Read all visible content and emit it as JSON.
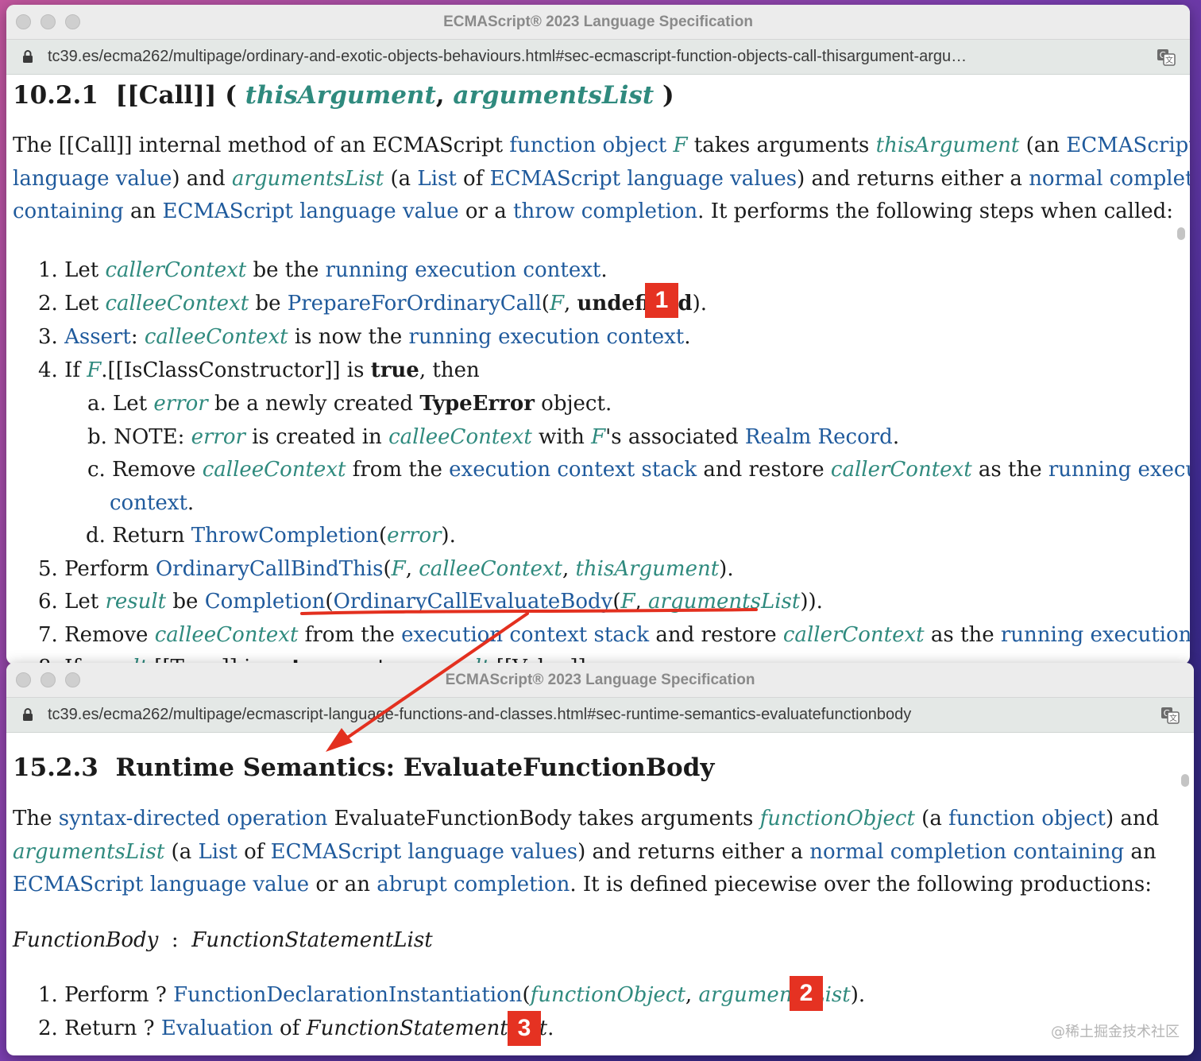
{
  "window1": {
    "title": "ECMAScript® 2023 Language Specification",
    "url": "tc39.es/ecma262/multipage/ordinary-and-exotic-objects-behaviours.html#sec-ecmascript-function-objects-call-thisargument-argu…",
    "heading": {
      "num": "10.2.1",
      "name": "[[Call]] (",
      "arg1": "thisArgument",
      "comma": ",",
      "arg2": "argumentsList",
      "close": ")"
    },
    "intro": {
      "l1_a": "The [[Call]] internal method of an ECMAScript ",
      "l1_link1": "function object",
      "l1_var1": "F",
      "l1_b": " takes arguments ",
      "l1_var2": "thisArgument",
      "l1_c": " (an ",
      "l1_link2": "ECMAScript",
      "l2_link1": "language value",
      "l2_a": ") and ",
      "l2_var1": "argumentsList",
      "l2_b": " (a ",
      "l2_link2": "List",
      "l2_c": " of ",
      "l2_link3": "ECMAScript language values",
      "l2_d": ") and returns either a ",
      "l2_link4": "normal completion",
      "l3_link1": "containing",
      "l3_a": " an ",
      "l3_link2": "ECMAScript language value",
      "l3_b": " or a ",
      "l3_link3": "throw completion",
      "l3_c": ". It performs the following steps when called:"
    },
    "steps": {
      "s1": {
        "n": "1.",
        "a": "Let ",
        "v1": "callerContext",
        "b": " be the ",
        "l1": "running execution context",
        "c": "."
      },
      "s2": {
        "n": "2.",
        "a": "Let ",
        "v1": "calleeContext",
        "b": " be ",
        "l1": "PrepareForOrdinaryCall",
        "c": "(",
        "v2": "F",
        "d": ", ",
        "bold": "undefined",
        "e": ")."
      },
      "s3": {
        "n": "3.",
        "l1": "Assert",
        "a": ": ",
        "v1": "calleeContext",
        "b": " is now the ",
        "l2": "running execution context",
        "c": "."
      },
      "s4": {
        "n": "4.",
        "a": "If ",
        "v1": "F",
        "b": ".[[IsClassConstructor]] is ",
        "bold": "true",
        "c": ", then"
      },
      "s4a": {
        "n": "a.",
        "a": "Let ",
        "v1": "error",
        "b": " be a newly created ",
        "bold": "TypeError",
        "c": " object."
      },
      "s4b": {
        "n": "b.",
        "a": "NOTE: ",
        "v1": "error",
        "b": " is created in ",
        "v2": "calleeContext",
        "c": " with ",
        "v3": "F",
        "d": "'s associated ",
        "l1": "Realm Record",
        "e": "."
      },
      "s4c": {
        "n": "c.",
        "a": "Remove ",
        "v1": "calleeContext",
        "b": " from the ",
        "l1": "execution context stack",
        "c": " and restore ",
        "v2": "callerContext",
        "d": " as the ",
        "l2": "running execution"
      },
      "s4c2": {
        "l1": "context",
        "a": "."
      },
      "s4d": {
        "n": "d.",
        "a": "Return ",
        "l1": "ThrowCompletion",
        "b": "(",
        "v1": "error",
        "c": ")."
      },
      "s5": {
        "n": "5.",
        "a": "Perform ",
        "l1": "OrdinaryCallBindThis",
        "b": "(",
        "v1": "F",
        "c": ", ",
        "v2": "calleeContext",
        "d": ", ",
        "v3": "thisArgument",
        "e": ")."
      },
      "s6": {
        "n": "6.",
        "a": "Let ",
        "v1": "result",
        "b": " be ",
        "l1": "Completion",
        "c": "(",
        "l2": "OrdinaryCallEvaluateBody",
        "d": "(",
        "v2": "F",
        "e": ", ",
        "v3": "argumentsList",
        "f": "))."
      },
      "s7": {
        "n": "7.",
        "a": "Remove ",
        "v1": "calleeContext",
        "b": " from the ",
        "l1": "execution context stack",
        "c": " and restore ",
        "v2": "callerContext",
        "d": " as the ",
        "l2": "running execution context",
        "e": "."
      },
      "s8": {
        "n": "8.",
        "a": "If ",
        "v1": "result",
        "b": ".[[Type]] is ",
        "bold": "return",
        "c": ", return ",
        "v2": "result",
        "d": ".[[Value]]."
      }
    },
    "badge": "1"
  },
  "window2": {
    "title": "ECMAScript® 2023 Language Specification",
    "url": "tc39.es/ecma262/multipage/ecmascript-language-functions-and-classes.html#sec-runtime-semantics-evaluatefunctionbody",
    "heading": {
      "num": "15.2.3",
      "name": "Runtime Semantics: EvaluateFunctionBody"
    },
    "intro": {
      "l1_a": "The ",
      "l1_link1": "syntax-directed operation",
      "l1_b": " EvaluateFunctionBody takes arguments ",
      "l1_var1": "functionObject",
      "l1_c": " (a ",
      "l1_link2": "function object",
      "l1_d": ") and",
      "l2_var1": "argumentsList",
      "l2_a": " (a ",
      "l2_link1": "List",
      "l2_b": " of ",
      "l2_link2": "ECMAScript language values",
      "l2_c": ") and returns either a ",
      "l2_link3": "normal completion containing",
      "l2_d": " an",
      "l3_link1": "ECMAScript language value",
      "l3_a": " or an ",
      "l3_link2": "abrupt completion",
      "l3_b": ". It is defined piecewise over the following productions:"
    },
    "production": {
      "lhs": "FunctionBody",
      "colon": ":",
      "rhs": "FunctionStatementList"
    },
    "steps": {
      "s1": {
        "n": "1.",
        "a": "Perform ? ",
        "l1": "FunctionDeclarationInstantiation",
        "b": "(",
        "v1": "functionObject",
        "c": ", ",
        "v2": "argumentsList",
        "d": ")."
      },
      "s2": {
        "n": "2.",
        "a": "Return ? ",
        "l1": "Evaluation",
        "b": " of ",
        "nt": "FunctionStatementList",
        "c": "."
      }
    },
    "badge2": "2",
    "badge3": "3"
  },
  "watermark": "@稀土掘金技术社区",
  "colors": {
    "link": "#1f5a9c",
    "variable": "#2f8a7e",
    "badge": "#e53222",
    "annotation": "#e3301f"
  },
  "icons": {
    "lock": "lock-icon",
    "translate": "translate-icon"
  }
}
